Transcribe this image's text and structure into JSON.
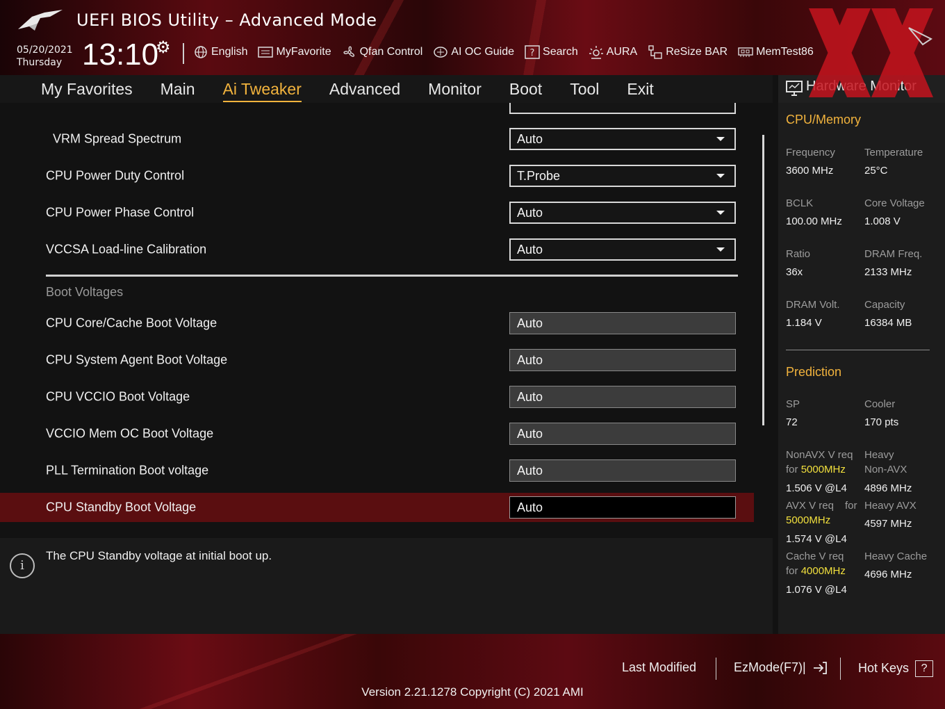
{
  "header": {
    "title": "UEFI BIOS Utility – Advanced Mode",
    "date": "05/20/2021",
    "weekday": "Thursday",
    "time": "13:10",
    "toolbar": [
      {
        "label": "English",
        "icon": "globe-icon"
      },
      {
        "label": "MyFavorite",
        "icon": "favorite-list-icon"
      },
      {
        "label": "Qfan Control",
        "icon": "fan-icon"
      },
      {
        "label": "AI OC Guide",
        "icon": "ai-chip-icon"
      },
      {
        "label": "Search",
        "icon": "help-search-icon"
      },
      {
        "label": "AURA",
        "icon": "aura-light-icon"
      },
      {
        "label": "ReSize BAR",
        "icon": "resize-bar-icon"
      },
      {
        "label": "MemTest86",
        "icon": "memory-icon"
      }
    ]
  },
  "nav": {
    "tabs": [
      "My Favorites",
      "Main",
      "Ai Tweaker",
      "Advanced",
      "Monitor",
      "Boot",
      "Tool",
      "Exit"
    ],
    "active": "Ai Tweaker"
  },
  "settings": {
    "rows": [
      {
        "label": "VRM Spread Spectrum",
        "value": "Auto",
        "type": "dropdown"
      },
      {
        "label": "CPU Power Duty Control",
        "value": "T.Probe",
        "type": "dropdown"
      },
      {
        "label": "CPU Power Phase Control",
        "value": "Auto",
        "type": "dropdown"
      },
      {
        "label": "VCCSA Load-line Calibration",
        "value": "Auto",
        "type": "dropdown"
      }
    ],
    "section_header": "Boot Voltages",
    "boot_rows": [
      {
        "label": "CPU Core/Cache Boot Voltage",
        "value": "Auto"
      },
      {
        "label": "CPU System Agent Boot Voltage",
        "value": "Auto"
      },
      {
        "label": "CPU VCCIO Boot Voltage",
        "value": "Auto"
      },
      {
        "label": "VCCIO Mem OC Boot Voltage",
        "value": "Auto"
      },
      {
        "label": "PLL Termination Boot voltage",
        "value": "Auto"
      },
      {
        "label": "CPU Standby Boot Voltage",
        "value": "Auto"
      }
    ]
  },
  "help": {
    "text": "The CPU Standby voltage at initial boot up."
  },
  "hw_monitor": {
    "title": "Hardware Monitor",
    "cpu_memory": {
      "heading": "CPU/Memory",
      "frequency_label": "Frequency",
      "frequency": "3600 MHz",
      "temperature_label": "Temperature",
      "temperature": "25°C",
      "bclk_label": "BCLK",
      "bclk": "100.00 MHz",
      "core_voltage_label": "Core Voltage",
      "core_voltage": "1.008 V",
      "ratio_label": "Ratio",
      "ratio": "36x",
      "dram_freq_label": "DRAM Freq.",
      "dram_freq": "2133 MHz",
      "dram_volt_label": "DRAM Volt.",
      "dram_volt": "1.184 V",
      "capacity_label": "Capacity",
      "capacity": "16384 MB"
    },
    "prediction": {
      "heading": "Prediction",
      "sp_label": "SP",
      "sp": "72",
      "cooler_label": "Cooler",
      "cooler": "170 pts",
      "nonavx_label_1": "NonAVX V req",
      "nonavx_for": "for",
      "nonavx_freq": "5000MHz",
      "nonavx_value": "1.506 V @L4",
      "heavy_nonavx_label_1": "Heavy",
      "heavy_nonavx_label_2": "Non-AVX",
      "heavy_nonavx_value": "4896 MHz",
      "avx_label_1": "AVX V req",
      "avx_for": "for",
      "avx_freq": "5000MHz",
      "avx_value": "1.574 V @L4",
      "heavy_avx_label": "Heavy AVX",
      "heavy_avx_value": "4597 MHz",
      "cache_label_1": "Cache V req",
      "cache_for": "for",
      "cache_freq": "4000MHz",
      "cache_value": "1.076 V @L4",
      "heavy_cache_label": "Heavy Cache",
      "heavy_cache_value": "4696 MHz"
    }
  },
  "footer": {
    "last_modified": "Last Modified",
    "ezmode": "EzMode(F7)|",
    "hotkeys": "Hot Keys",
    "hotkeys_key": "?",
    "version": "Version 2.21.1278 Copyright (C) 2021 AMI"
  },
  "colors": {
    "accent": "#f2b33d",
    "highlight": "#f2e03d",
    "selected_row": "#5a0e10",
    "brand_red": "#6a0c14"
  }
}
